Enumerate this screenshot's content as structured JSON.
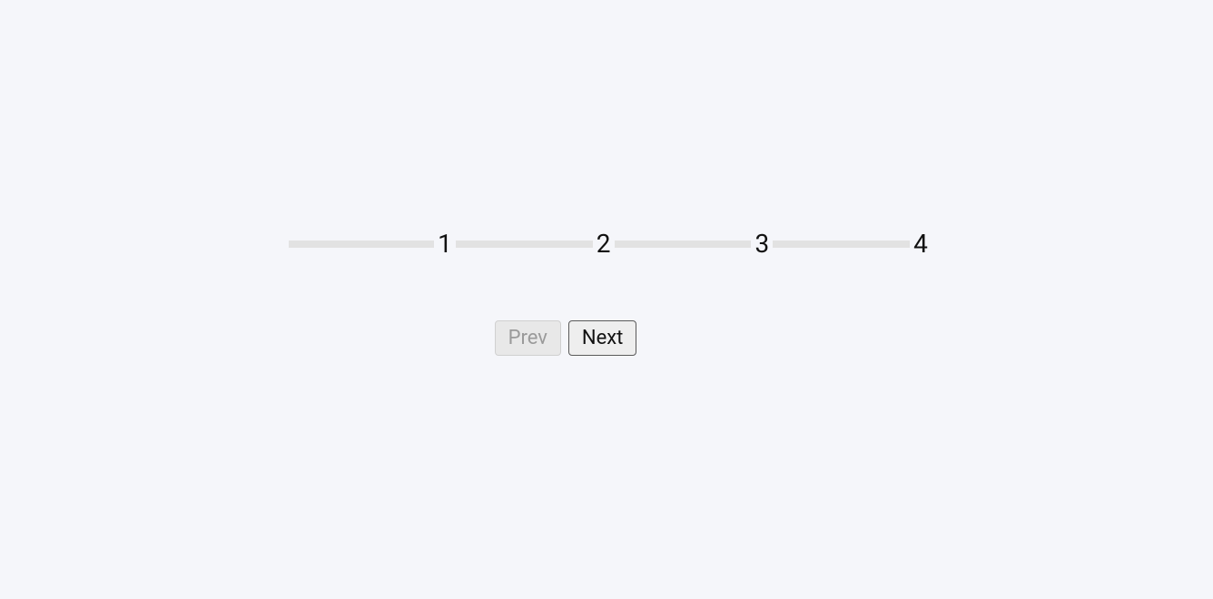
{
  "progress": {
    "steps": [
      "1",
      "2",
      "3",
      "4"
    ]
  },
  "controls": {
    "prev_label": "Prev",
    "next_label": "Next"
  }
}
